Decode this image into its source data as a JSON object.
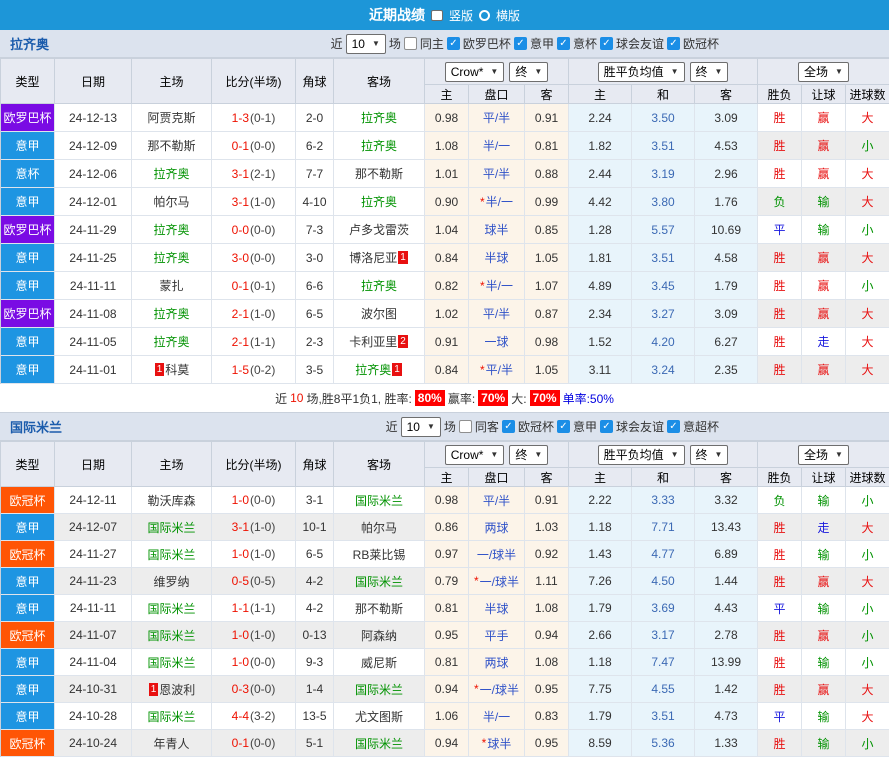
{
  "titlebar": {
    "title": "近期战绩",
    "options": [
      {
        "label": "竖版",
        "selected": true
      },
      {
        "label": "横版",
        "selected": false
      }
    ]
  },
  "colors": {
    "topbar": "#1d96d8",
    "summary_highlight_bg": "#ff0000",
    "single_rate_text": "#0000e0",
    "focus_team_text": "#009200"
  },
  "league_colors": {
    "欧罗巴杯": "#7a0be4",
    "意甲": "#1e95e2",
    "意杯": "#1e95e2",
    "欧冠杯": "#ff5505"
  },
  "result_colors": {
    "胜": "#e81010",
    "平": "#1717dd",
    "负": "#009200",
    "赢": "#e81010",
    "走": "#1717dd",
    "输": "#009200",
    "大": "#e81010",
    "小": "#009200"
  },
  "filter_labels": {
    "near": "近",
    "count": "10",
    "games": "场"
  },
  "table_header": {
    "cols": [
      "类型",
      "日期",
      "主场",
      "比分(半场)",
      "角球",
      "客场"
    ],
    "group1": {
      "selects": [
        "Crow*",
        "终"
      ],
      "subs": [
        "主",
        "盘口",
        "客"
      ]
    },
    "group2": {
      "selects": [
        "胜平负均值",
        "终"
      ],
      "subs": [
        "主",
        "和",
        "客"
      ]
    },
    "group3": {
      "selects": [
        "全场"
      ],
      "subs": [
        "胜负",
        "让球",
        "进球数"
      ]
    }
  },
  "sections": [
    {
      "team": "拉齐奥",
      "same_label": "同主",
      "leagues": [
        "欧罗巴杯",
        "意甲",
        "意杯",
        "球会友谊",
        "欧冠杯"
      ],
      "zebra_full": false,
      "rows": [
        {
          "type": "欧罗巴杯",
          "date": "24-12-13",
          "home": "阿贾克斯",
          "score": "1-3",
          "half": "(0-1)",
          "corner": "2-0",
          "away": "拉齐奥",
          "odds_home": "0.98",
          "handicap": "平/半",
          "star": false,
          "odds_away": "0.91",
          "avg_home": "2.24",
          "avg_draw": "3.50",
          "avg_away": "3.09",
          "result": "胜",
          "handicap_result": "赢",
          "goal_result": "大"
        },
        {
          "type": "意甲",
          "date": "24-12-09",
          "home": "那不勒斯",
          "score": "0-1",
          "half": "(0-0)",
          "corner": "6-2",
          "away": "拉齐奥",
          "odds_home": "1.08",
          "handicap": "半/一",
          "star": false,
          "odds_away": "0.81",
          "avg_home": "1.82",
          "avg_draw": "3.51",
          "avg_away": "4.53",
          "result": "胜",
          "handicap_result": "赢",
          "goal_result": "小"
        },
        {
          "type": "意杯",
          "date": "24-12-06",
          "home": "拉齐奥",
          "score": "3-1",
          "half": "(2-1)",
          "corner": "7-7",
          "away": "那不勒斯",
          "odds_home": "1.01",
          "handicap": "平/半",
          "star": false,
          "odds_away": "0.88",
          "avg_home": "2.44",
          "avg_draw": "3.19",
          "avg_away": "2.96",
          "result": "胜",
          "handicap_result": "赢",
          "goal_result": "大"
        },
        {
          "type": "意甲",
          "date": "24-12-01",
          "home": "帕尔马",
          "score": "3-1",
          "half": "(1-0)",
          "corner": "4-10",
          "away": "拉齐奥",
          "odds_home": "0.90",
          "handicap": "半/一",
          "star": true,
          "odds_away": "0.99",
          "avg_home": "4.42",
          "avg_draw": "3.80",
          "avg_away": "1.76",
          "result": "负",
          "handicap_result": "输",
          "goal_result": "大"
        },
        {
          "type": "欧罗巴杯",
          "date": "24-11-29",
          "home": "拉齐奥",
          "score": "0-0",
          "half": "(0-0)",
          "corner": "7-3",
          "away": "卢多戈雷茨",
          "odds_home": "1.04",
          "handicap": "球半",
          "star": false,
          "odds_away": "0.85",
          "avg_home": "1.28",
          "avg_draw": "5.57",
          "avg_away": "10.69",
          "result": "平",
          "handicap_result": "输",
          "goal_result": "小"
        },
        {
          "type": "意甲",
          "date": "24-11-25",
          "home": "拉齐奥",
          "score": "3-0",
          "half": "(0-0)",
          "corner": "3-0",
          "away": "博洛尼亚",
          "away_badge": {
            "pos": "after",
            "num": "1"
          },
          "odds_home": "0.84",
          "handicap": "半球",
          "star": false,
          "odds_away": "1.05",
          "avg_home": "1.81",
          "avg_draw": "3.51",
          "avg_away": "4.58",
          "result": "胜",
          "handicap_result": "赢",
          "goal_result": "大"
        },
        {
          "type": "意甲",
          "date": "24-11-11",
          "home": "蒙扎",
          "score": "0-1",
          "half": "(0-1)",
          "corner": "6-6",
          "away": "拉齐奥",
          "odds_home": "0.82",
          "handicap": "半/一",
          "star": true,
          "odds_away": "1.07",
          "avg_home": "4.89",
          "avg_draw": "3.45",
          "avg_away": "1.79",
          "result": "胜",
          "handicap_result": "赢",
          "goal_result": "小"
        },
        {
          "type": "欧罗巴杯",
          "date": "24-11-08",
          "home": "拉齐奥",
          "score": "2-1",
          "half": "(1-0)",
          "corner": "6-5",
          "away": "波尔图",
          "odds_home": "1.02",
          "handicap": "平/半",
          "star": false,
          "odds_away": "0.87",
          "avg_home": "2.34",
          "avg_draw": "3.27",
          "avg_away": "3.09",
          "result": "胜",
          "handicap_result": "赢",
          "goal_result": "大"
        },
        {
          "type": "意甲",
          "date": "24-11-05",
          "home": "拉齐奥",
          "score": "2-1",
          "half": "(1-1)",
          "corner": "2-3",
          "away": "卡利亚里",
          "away_badge": {
            "pos": "after",
            "num": "2"
          },
          "odds_home": "0.91",
          "handicap": "一球",
          "star": false,
          "odds_away": "0.98",
          "avg_home": "1.52",
          "avg_draw": "4.20",
          "avg_away": "6.27",
          "result": "胜",
          "handicap_result": "走",
          "goal_result": "大"
        },
        {
          "type": "意甲",
          "date": "24-11-01",
          "home": "科莫",
          "home_badge": {
            "pos": "before",
            "num": "1"
          },
          "score": "1-5",
          "half": "(0-2)",
          "corner": "3-5",
          "away": "拉齐奥",
          "away_badge": {
            "pos": "after",
            "num": "1"
          },
          "odds_home": "0.84",
          "handicap": "平/半",
          "star": true,
          "odds_away": "1.05",
          "avg_home": "3.11",
          "avg_draw": "3.24",
          "avg_away": "2.35",
          "result": "胜",
          "handicap_result": "赢",
          "goal_result": "大"
        }
      ],
      "summary": {
        "seg1": "近",
        "count": "10",
        "seg2": "场,胜8平1负1, 胜率:",
        "win_rate": "80%",
        "seg3": "赢率:",
        "odds_rate": "70%",
        "seg4": "大:",
        "big_rate": "70%",
        "seg5": "单率:50%"
      }
    },
    {
      "team": "国际米兰",
      "same_label": "同客",
      "leagues": [
        "欧冠杯",
        "意甲",
        "球会友谊",
        "意超杯"
      ],
      "zebra_full": true,
      "rows": [
        {
          "type": "欧冠杯",
          "date": "24-12-11",
          "home": "勒沃库森",
          "score": "1-0",
          "half": "(0-0)",
          "corner": "3-1",
          "away": "国际米兰",
          "odds_home": "0.98",
          "handicap": "平/半",
          "star": false,
          "odds_away": "0.91",
          "avg_home": "2.22",
          "avg_draw": "3.33",
          "avg_away": "3.32",
          "result": "负",
          "handicap_result": "输",
          "goal_result": "小"
        },
        {
          "type": "意甲",
          "date": "24-12-07",
          "home": "国际米兰",
          "score": "3-1",
          "half": "(1-0)",
          "corner": "10-1",
          "away": "帕尔马",
          "odds_home": "0.86",
          "handicap": "两球",
          "star": false,
          "odds_away": "1.03",
          "avg_home": "1.18",
          "avg_draw": "7.71",
          "avg_away": "13.43",
          "result": "胜",
          "handicap_result": "走",
          "goal_result": "大"
        },
        {
          "type": "欧冠杯",
          "date": "24-11-27",
          "home": "国际米兰",
          "score": "1-0",
          "half": "(1-0)",
          "corner": "6-5",
          "away": "RB莱比锡",
          "odds_home": "0.97",
          "handicap": "一/球半",
          "star": false,
          "odds_away": "0.92",
          "avg_home": "1.43",
          "avg_draw": "4.77",
          "avg_away": "6.89",
          "result": "胜",
          "handicap_result": "输",
          "goal_result": "小"
        },
        {
          "type": "意甲",
          "date": "24-11-23",
          "home": "维罗纳",
          "score": "0-5",
          "half": "(0-5)",
          "corner": "4-2",
          "away": "国际米兰",
          "odds_home": "0.79",
          "handicap": "一/球半",
          "star": true,
          "odds_away": "1.11",
          "avg_home": "7.26",
          "avg_draw": "4.50",
          "avg_away": "1.44",
          "result": "胜",
          "handicap_result": "赢",
          "goal_result": "大"
        },
        {
          "type": "意甲",
          "date": "24-11-11",
          "home": "国际米兰",
          "score": "1-1",
          "half": "(1-1)",
          "corner": "4-2",
          "away": "那不勒斯",
          "odds_home": "0.81",
          "handicap": "半球",
          "star": false,
          "odds_away": "1.08",
          "avg_home": "1.79",
          "avg_draw": "3.69",
          "avg_away": "4.43",
          "result": "平",
          "handicap_result": "输",
          "goal_result": "小"
        },
        {
          "type": "欧冠杯",
          "date": "24-11-07",
          "home": "国际米兰",
          "score": "1-0",
          "half": "(1-0)",
          "corner": "0-13",
          "away": "阿森纳",
          "odds_home": "0.95",
          "handicap": "平手",
          "star": false,
          "odds_away": "0.94",
          "avg_home": "2.66",
          "avg_draw": "3.17",
          "avg_away": "2.78",
          "result": "胜",
          "handicap_result": "赢",
          "goal_result": "小"
        },
        {
          "type": "意甲",
          "date": "24-11-04",
          "home": "国际米兰",
          "score": "1-0",
          "half": "(0-0)",
          "corner": "9-3",
          "away": "威尼斯",
          "odds_home": "0.81",
          "handicap": "两球",
          "star": false,
          "odds_away": "1.08",
          "avg_home": "1.18",
          "avg_draw": "7.47",
          "avg_away": "13.99",
          "result": "胜",
          "handicap_result": "输",
          "goal_result": "小"
        },
        {
          "type": "意甲",
          "date": "24-10-31",
          "home": "恩波利",
          "home_badge": {
            "pos": "before",
            "num": "1"
          },
          "score": "0-3",
          "half": "(0-0)",
          "corner": "1-4",
          "away": "国际米兰",
          "odds_home": "0.94",
          "handicap": "一/球半",
          "star": true,
          "odds_away": "0.95",
          "avg_home": "7.75",
          "avg_draw": "4.55",
          "avg_away": "1.42",
          "result": "胜",
          "handicap_result": "赢",
          "goal_result": "大"
        },
        {
          "type": "意甲",
          "date": "24-10-28",
          "home": "国际米兰",
          "score": "4-4",
          "half": "(3-2)",
          "corner": "13-5",
          "away": "尤文图斯",
          "odds_home": "1.06",
          "handicap": "半/一",
          "star": false,
          "odds_away": "0.83",
          "avg_home": "1.79",
          "avg_draw": "3.51",
          "avg_away": "4.73",
          "result": "平",
          "handicap_result": "输",
          "goal_result": "大"
        },
        {
          "type": "欧冠杯",
          "date": "24-10-24",
          "home": "年青人",
          "score": "0-1",
          "half": "(0-0)",
          "corner": "5-1",
          "away": "国际米兰",
          "odds_home": "0.94",
          "handicap": "球半",
          "star": true,
          "odds_away": "0.95",
          "avg_home": "8.59",
          "avg_draw": "5.36",
          "avg_away": "1.33",
          "result": "胜",
          "handicap_result": "输",
          "goal_result": "小"
        }
      ],
      "summary": null
    }
  ]
}
